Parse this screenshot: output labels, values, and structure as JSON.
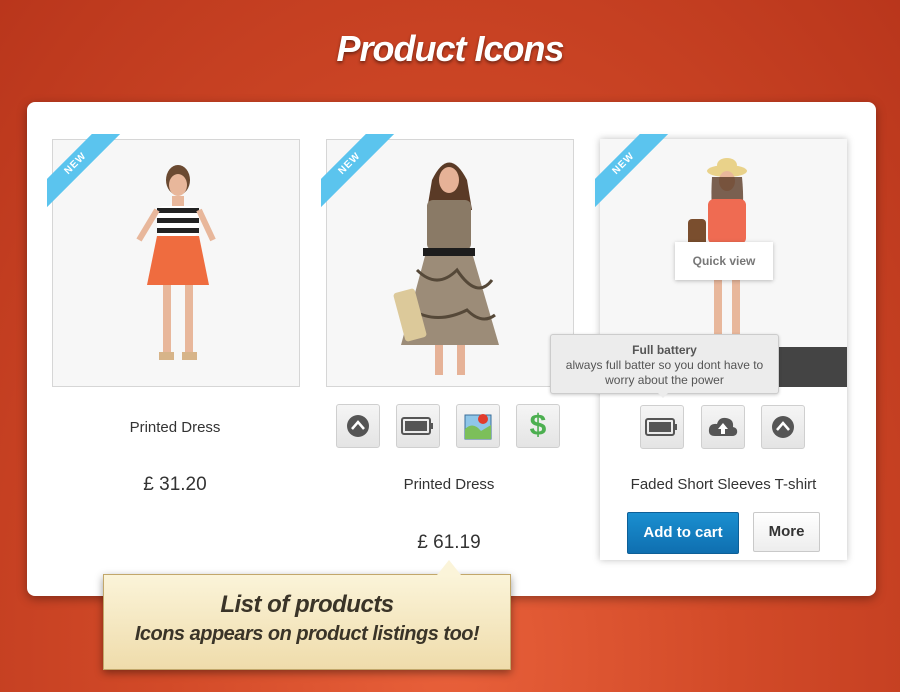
{
  "header": {
    "title": "Product Icons"
  },
  "badge_label": "NEW",
  "products": [
    {
      "name": "Printed Dress",
      "price": "£ 31.20"
    },
    {
      "name": "Printed Dress",
      "price": "£ 61.19",
      "icons": [
        "up-arrow-icon",
        "battery-icon",
        "map-icon",
        "dollar-icon"
      ]
    },
    {
      "name": "Faded Short Sleeves T-shirt",
      "quick_view": "Quick view",
      "icons": [
        "battery-icon",
        "cloud-upload-icon",
        "up-arrow-icon"
      ],
      "tooltip": {
        "title": "Full battery",
        "text": "always full batter so you dont have to worry about the power"
      },
      "add_to_cart": "Add to cart",
      "more": "More"
    }
  ],
  "callout": {
    "line1": "List of products",
    "line2": "Icons appears on product listings too!"
  },
  "colors": {
    "background": "#d24a28",
    "ribbon": "#5bc4ee",
    "cart_button": "#1a8fd0"
  }
}
